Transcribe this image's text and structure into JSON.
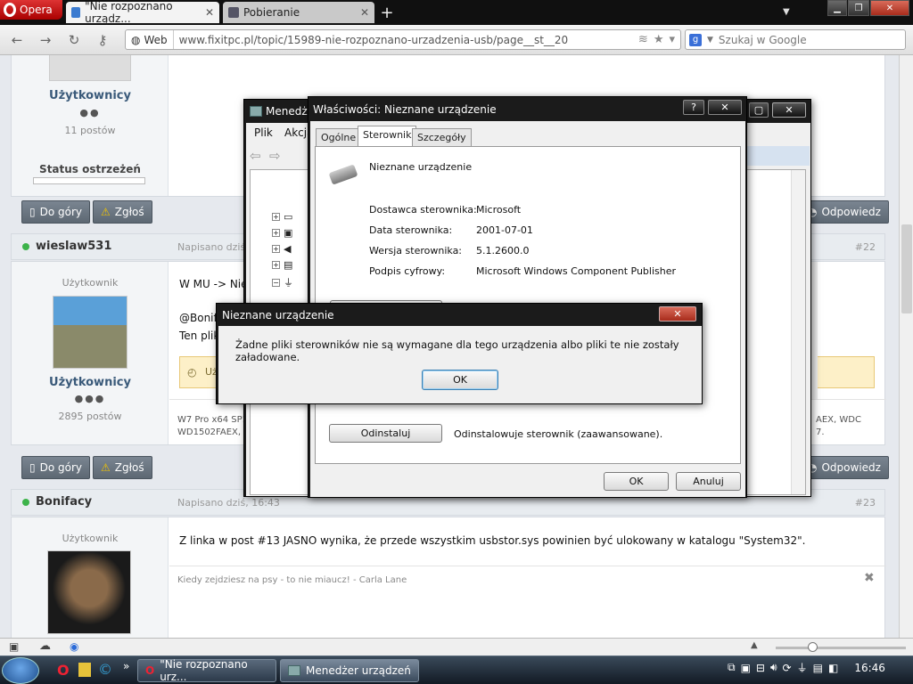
{
  "browser": {
    "menu_label": "Opera",
    "tabs": [
      {
        "label": "\"Nie rozpoznano urządz...",
        "active": true
      },
      {
        "label": "Pobieranie",
        "active": false
      }
    ],
    "address": {
      "site_label": "Web",
      "url": "www.fixitpc.pl/topic/15989-nie-rozpoznano-urzadzenia-usb/page__st__20"
    },
    "search_placeholder": "Szukaj w Google"
  },
  "forum": {
    "top_profile": {
      "group": "Użytkownicy",
      "posts": "11 postów",
      "warn_label": "Status ostrzeżeń"
    },
    "actions": {
      "top": "Do góry",
      "report": "Zgłoś",
      "reply": "Odpowiedz"
    },
    "posts": [
      {
        "author": "wieslaw531",
        "date": "Napisano dziś,",
        "number": "#22",
        "role": "Użytkownik",
        "group": "Użytkownicy",
        "count": "2895 postów",
        "body_lines": [
          "W MU -> Nie",
          "@Bonifa",
          "Ten plik"
        ],
        "quote_stub": "Uż",
        "sig_left": "W7 Pro x64 SP1",
        "sig_left2": "WD1502FAEX, S",
        "sig_right": "AEX, WDC",
        "sig_right2": "7."
      },
      {
        "author": "Bonifacy",
        "date": "Napisano dziś, 16:43",
        "number": "#23",
        "role": "Użytkownik",
        "body": "Z linka w post #13 JASNO wynika, że przede wszystkim usbstor.sys powinien być ulokowany w katalogu \"System32\".",
        "signature": "Kiedy zejdziesz na psy - to nie miaucz! - Carla Lane"
      }
    ]
  },
  "device_manager": {
    "title": "Menedże",
    "menu": [
      "Plik",
      "Akcja"
    ]
  },
  "properties": {
    "title": "Właściwości: Nieznane urządzenie",
    "help": "?",
    "tabs": [
      "Ogólne",
      "Sterownik",
      "Szczegóły"
    ],
    "device_name": "Nieznane urządzenie",
    "fields": [
      {
        "label": "Dostawca sterownika:",
        "value": "Microsoft"
      },
      {
        "label": "Data sterownika:",
        "value": "2001-07-01"
      },
      {
        "label": "Wersja sterownika:",
        "value": "5.1.2600.0"
      },
      {
        "label": "Podpis cyfrowy:",
        "value": "Microsoft Windows Component Publisher"
      }
    ],
    "uninstall_button": "Odinstaluj",
    "uninstall_desc": "Odinstalowuje sterownik (zaawansowane).",
    "ok": "OK",
    "cancel": "Anuluj"
  },
  "msgbox": {
    "title": "Nieznane urządzenie",
    "message": "Żadne pliki sterowników nie są wymagane dla tego urządzenia albo pliki te nie zostały załadowane.",
    "ok": "OK"
  },
  "taskbar": {
    "items": [
      "\"Nie rozpoznano urz...",
      "Menedżer urządzeń"
    ],
    "clock": "16:46"
  }
}
